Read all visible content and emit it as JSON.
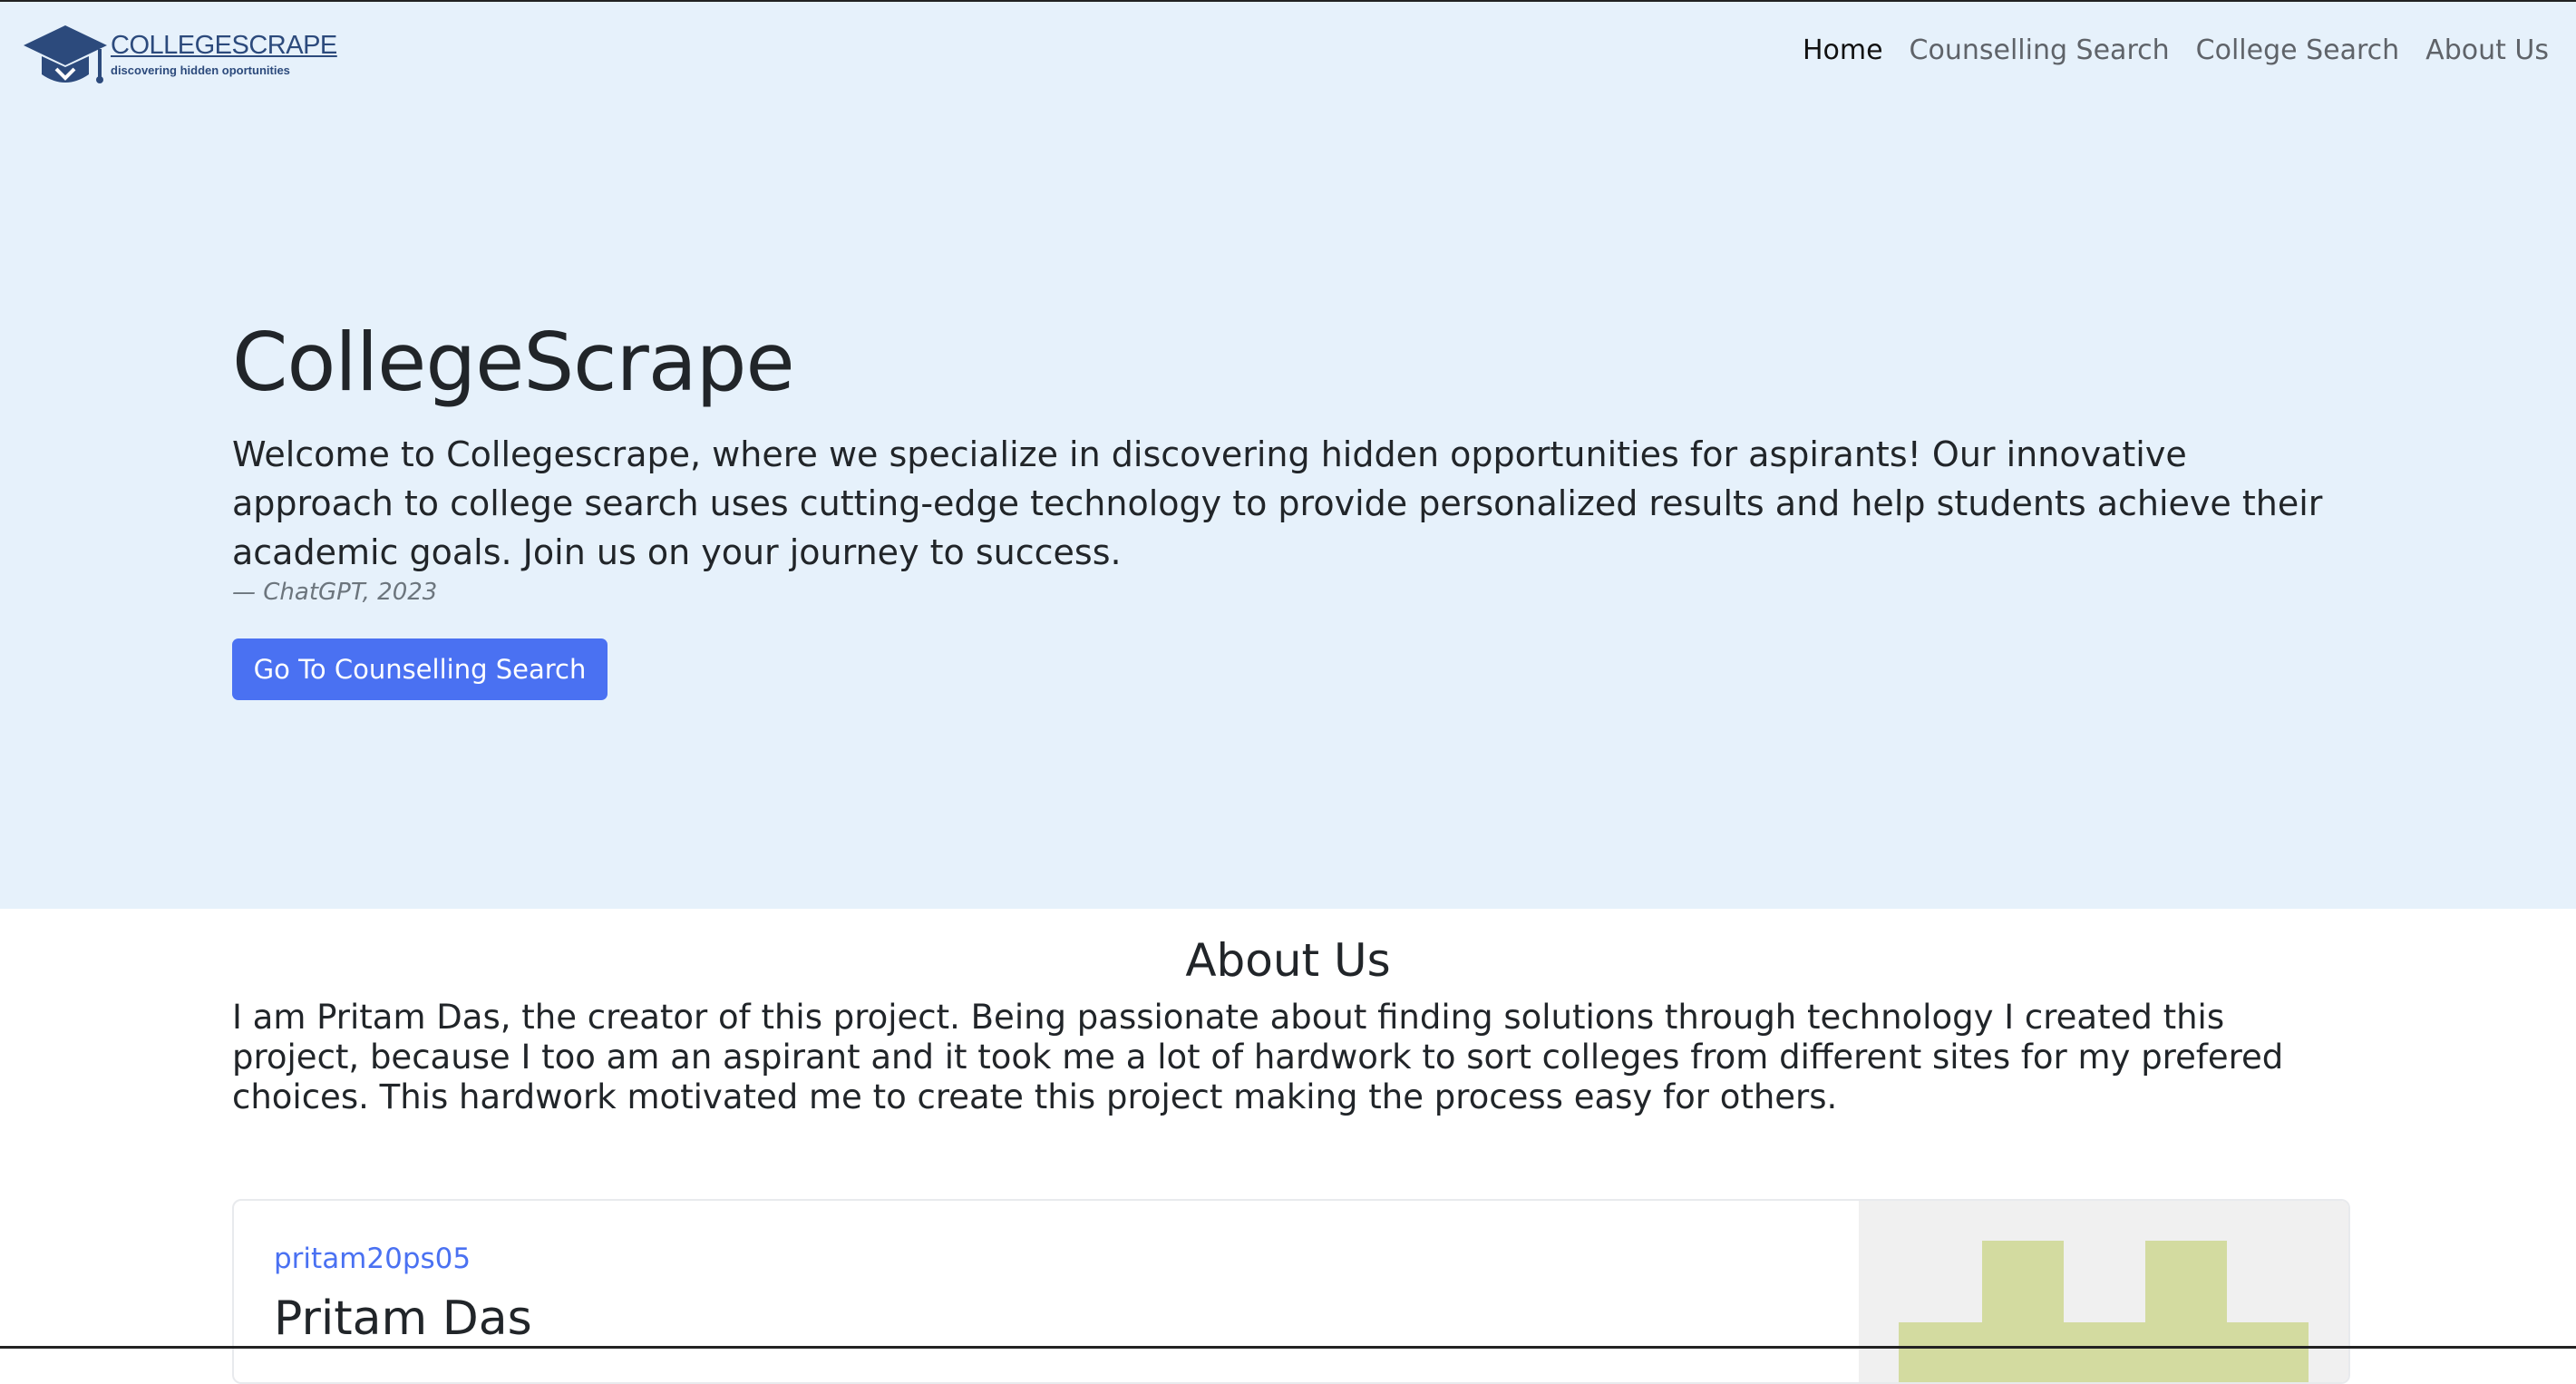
{
  "brand": {
    "name": "COLLEGESCRAPE",
    "tagline": "discovering hidden oportunities",
    "logo_icon": "graduation-cap-icon",
    "logo_color": "#2c4a7c"
  },
  "nav": {
    "items": [
      {
        "label": "Home",
        "active": true
      },
      {
        "label": "Counselling Search",
        "active": false
      },
      {
        "label": "College Search",
        "active": false
      },
      {
        "label": "About Us",
        "active": false
      }
    ]
  },
  "hero": {
    "title": "CollegeScrape",
    "quote": "Welcome to Collegescrape, where we specialize in discovering hidden opportunities for aspirants! Our innovative approach to college search uses cutting-edge technology to provide personalized results and help students achieve their academic goals. Join us on your journey to success.",
    "cite": "— ChatGPT, 2023",
    "button_label": "Go To Counselling Search",
    "background": "#e6f1fb",
    "button_color": "#4a71f2"
  },
  "about": {
    "title": "About Us",
    "text": "I am Pritam Das, the creator of this project. Being passionate about finding solutions through technology I created this project, because I too am an aspirant and it took me a lot of hardwork to sort colleges from different sites for my prefered choices. This hardwork motivated me to create this project making the process easy for others."
  },
  "profile_card": {
    "username": "pritam20ps05",
    "name": "Pritam Das",
    "avatar_icon": "identicon-avatar",
    "avatar_color": "#d3dba0"
  }
}
